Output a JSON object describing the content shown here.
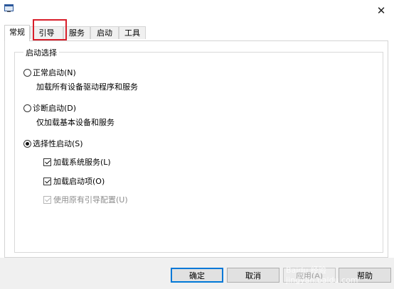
{
  "window": {
    "icon": "window-app-icon",
    "close_glyph": "✕"
  },
  "tabs": [
    {
      "label": "常规",
      "active": true
    },
    {
      "label": "引导",
      "active": false
    },
    {
      "label": "服务",
      "active": false
    },
    {
      "label": "启动",
      "active": false
    },
    {
      "label": "工具",
      "active": false
    }
  ],
  "startup_selection": {
    "title": "启动选择",
    "normal": {
      "label": "正常启动(N)",
      "description": "加载所有设备驱动程序和服务",
      "selected": false
    },
    "diagnostic": {
      "label": "诊断启动(D)",
      "description": "仅加载基本设备和服务",
      "selected": false
    },
    "selective": {
      "label": "选择性启动(S)",
      "selected": true
    },
    "options": {
      "load_system_services": {
        "label": "加载系统服务(L)",
        "checked": true,
        "enabled": true
      },
      "load_startup_items": {
        "label": "加载启动项(O)",
        "checked": true,
        "enabled": true
      },
      "use_original_boot": {
        "label": "使用原有引导配置(U)",
        "checked": true,
        "enabled": false
      }
    }
  },
  "buttons": {
    "ok": "确定",
    "cancel": "取消",
    "apply": "应用(A)",
    "help": "帮助"
  },
  "watermark": "Baidu 经验 jingyan.baidu.com",
  "colors": {
    "highlight_box": "#d81e2a",
    "primary_button_border": "#0078d7"
  }
}
